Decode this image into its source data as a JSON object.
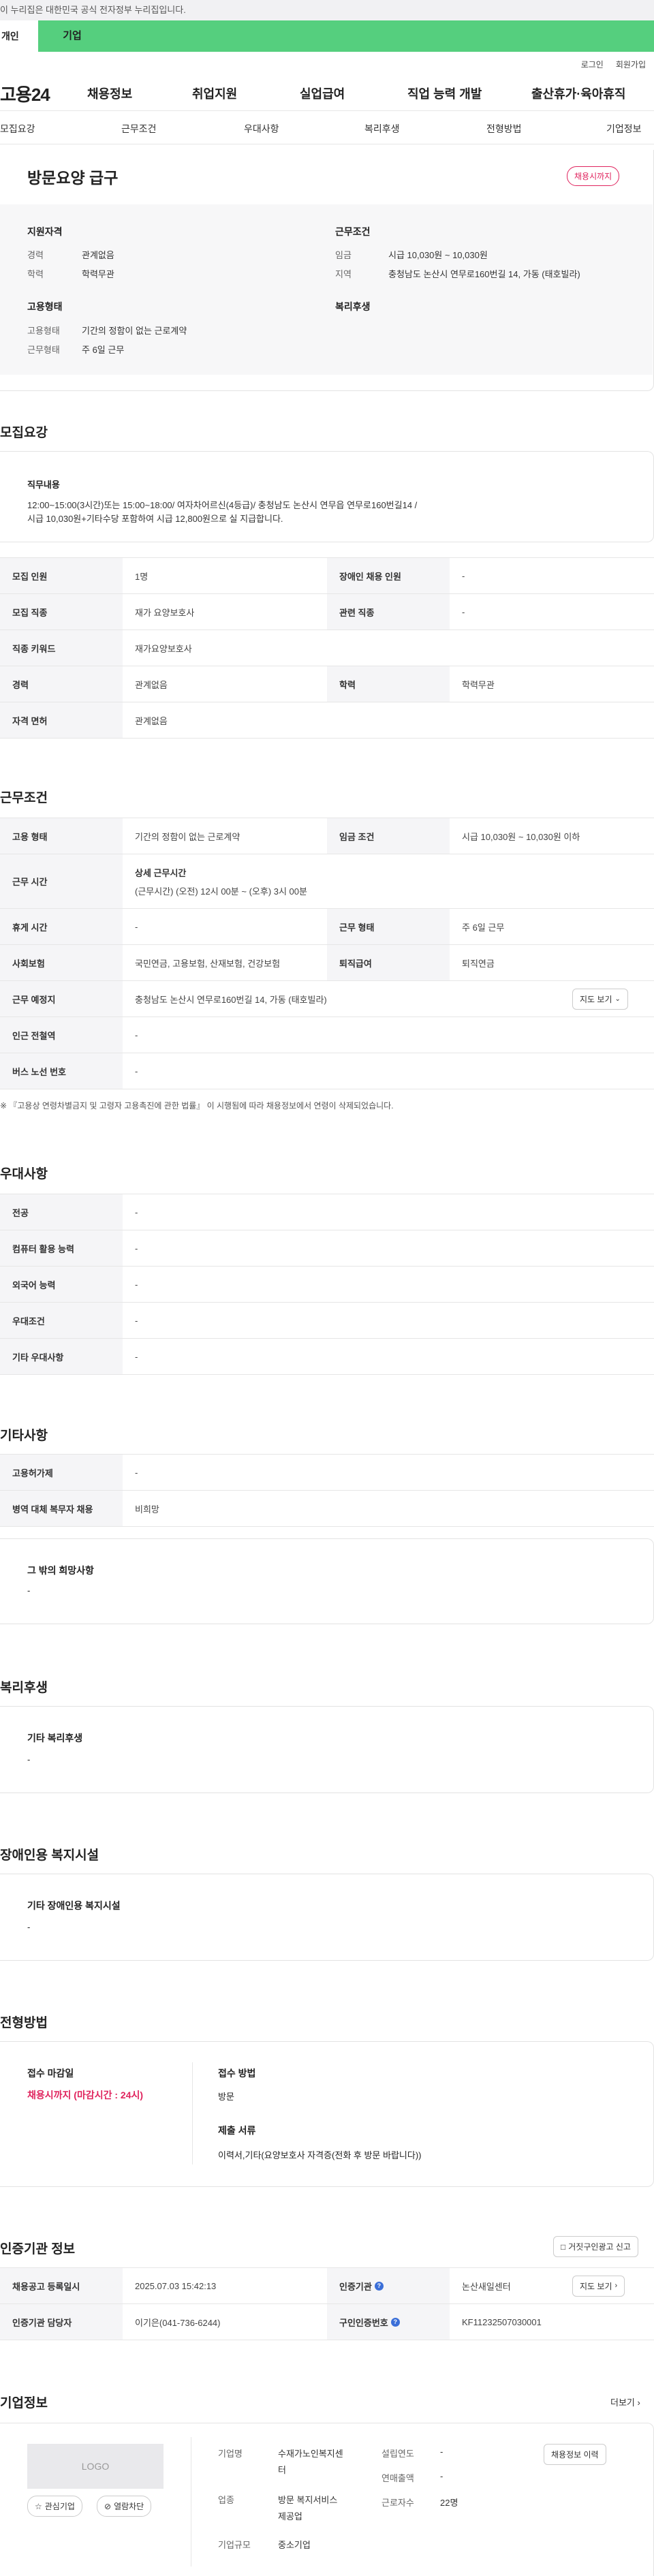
{
  "gov_notice": "이 누리집은 대한민국 공식 전자정부 누리집입니다.",
  "top_tabs": [
    "개인",
    "기업"
  ],
  "util_links": [
    "로그인",
    "회원가입"
  ],
  "gnb": {
    "logo": "고용24",
    "menu": [
      "채용정보",
      "취업지원",
      "실업급여",
      "직업 능력 개발",
      "출산휴가·육아휴직"
    ]
  },
  "subnav": [
    "모집요강",
    "근무조건",
    "우대사항",
    "복리후생",
    "전형방법",
    "기업정보"
  ],
  "job": {
    "title": "방문요양 급구",
    "status_badge": "채용시까지",
    "qual_title": "지원자격",
    "career_label": "경력",
    "career_value": "관계없음",
    "edu_label": "학력",
    "edu_value": "학력무관",
    "emp_title": "고용형태",
    "emp_type_label": "고용형태",
    "emp_type_value": "기간의 정함이 없는 근로계약",
    "work_type_label": "근무형태",
    "work_type_value": "주 6일 근무",
    "cond_title": "근무조건",
    "wage_label": "임금",
    "wage_value": "시급 10,030원 ~ 10,030원",
    "region_label": "지역",
    "region_value": "충청남도 논산시 연무로160번길 14, 가동 (태호빌라)",
    "welfare_title": "복리후생"
  },
  "recruit": {
    "title": "모집요강",
    "duty_label": "직무내용",
    "duty_line1": "12:00~15:00(3시간)또는 15:00~18:00/ 여자차어르신(4등급)/ 충청남도 논산시 연무읍 연무로160번길14   /",
    "duty_line2": "시급 10,030원+기타수당  포함하여 시급 12,800원으로 실 지급합니다.",
    "rows": [
      {
        "h1": "모집 인원",
        "v1": "1명",
        "h2": "장애인 채용 인원",
        "v2": "-"
      },
      {
        "h1": "모집 직종",
        "v1": "재가 요양보호사",
        "h2": "관련 직종",
        "v2": "-"
      },
      {
        "h1": "직종 키워드",
        "v1": "재가요양보호사"
      },
      {
        "h1": "경력",
        "v1": "관계없음",
        "h2": "학력",
        "v2": "학력무관"
      },
      {
        "h1": "자격 면허",
        "v1": "관계없음"
      }
    ]
  },
  "conditions": {
    "title": "근무조건",
    "emp_type_h": "고용 형태",
    "emp_type_v": "기간의 정함이 없는 근로계약",
    "wage_h": "임금 조건",
    "wage_v": "시급 10,030원 ~ 10,030원 이하",
    "hours_h": "근무 시간",
    "hours_detail_label": "상세 근무시간",
    "hours_detail_value": "(근무시간) (오전) 12시 00분 ~ (오후) 3시 00분",
    "break_h": "휴게 시간",
    "break_v": "-",
    "worktype_h": "근무 형태",
    "worktype_v": "주 6일 근무",
    "insurance_h": "사회보험",
    "insurance_v": "국민연금, 고용보험, 산재보험, 건강보험",
    "severance_h": "퇴직급여",
    "severance_v": "퇴직연금",
    "place_h": "근무 예정지",
    "place_v": "충청남도 논산시 연무로160번길 14, 가동 (태호빌라)",
    "map_btn": "지도 보기",
    "subway_h": "인근 전철역",
    "subway_v": "-",
    "bus_h": "버스 노선 번호",
    "bus_v": "-",
    "note": "※ 『고용상 연령차별금지 및 고령자 고용촉진에 관한 법률』 이 시행됨에 따라 채용정보에서 연령이 삭제되었습니다."
  },
  "preference": {
    "title": "우대사항",
    "rows": [
      {
        "h": "전공",
        "v": "-"
      },
      {
        "h": "컴퓨터 활용 능력",
        "v": "-"
      },
      {
        "h": "외국어 능력",
        "v": "-"
      },
      {
        "h": "우대조건",
        "v": "-"
      },
      {
        "h": "기타 우대사항",
        "v": "-"
      }
    ]
  },
  "etc": {
    "title": "기타사항",
    "rows": [
      {
        "h": "고용허가제",
        "v": "-"
      },
      {
        "h": "병역 대체 복무자 채용",
        "v": "비희망"
      }
    ],
    "other_label": "그 밖의 희망사항",
    "other_value": "-"
  },
  "welfare": {
    "title": "복리후생",
    "label": "기타 복리후생",
    "value": "-"
  },
  "disabled": {
    "title": "장애인용 복지시설",
    "label": "기타 장애인용 복지시설",
    "value": "-"
  },
  "selection": {
    "title": "전형방법",
    "deadline_label": "접수 마감일",
    "deadline_value": "채용시까지 (마감시간 : 24시)",
    "method_label": "접수 방법",
    "method_value": "방문",
    "docs_label": "제출 서류",
    "docs_value": "이력서,기타(요양보호사 자격증(전화 후 방문 바랍니다))"
  },
  "cert": {
    "title": "인증기관 정보",
    "report_btn": "거짓구인광고 신고",
    "reg_date_h": "채용공고 등록일시",
    "reg_date_v": "2025.07.03 15:42:13",
    "agency_h": "인증기관",
    "agency_v": "논산새일센터",
    "map_btn": "지도 보기",
    "manager_h": "인증기관 담당자",
    "manager_v": "이기은(041-736-6244)",
    "job_no_h": "구인인증번호",
    "job_no_v": "KF11232507030001"
  },
  "company": {
    "title": "기업정보",
    "more": "더보기",
    "logo_text": "LOGO",
    "fav_btn": "관심기업",
    "block_btn": "열람차단",
    "name_label": "기업명",
    "name_value_line1": "수재가노인복지센",
    "name_value_line2": "터",
    "industry_label": "업종",
    "industry_value_line1": "방문 복지서비스",
    "industry_value_line2": "제공업",
    "size_label": "기업규모",
    "size_value": "중소기업",
    "founded_label": "설립연도",
    "founded_value": "-",
    "revenue_label": "연매출액",
    "revenue_value": "-",
    "employees_label": "근로자수",
    "employees_value": "22명",
    "history_btn": "채용정보 이력"
  },
  "colors": {
    "accent_green": "#55cf7e",
    "deadline_red": "#e0245e",
    "info_blue": "#3b6fd8"
  }
}
